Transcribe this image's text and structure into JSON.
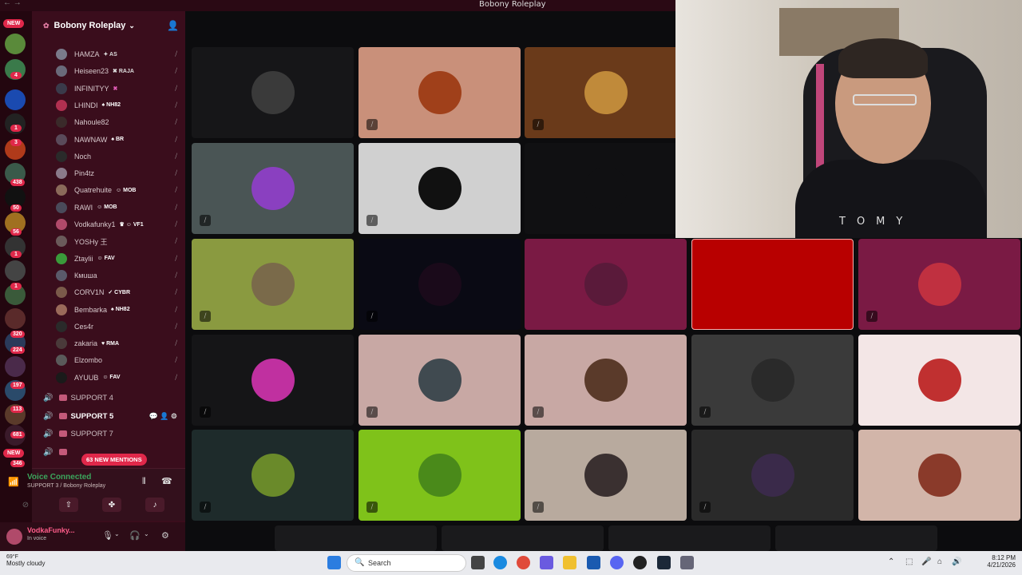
{
  "window": {
    "title": "Bobony Roleplay"
  },
  "rail": {
    "new_top": "NEW",
    "new_bottom": "NEW",
    "badges": [
      "4",
      "1",
      "3",
      "438",
      "50",
      "56",
      "1",
      "1",
      "320",
      "224",
      "197",
      "113",
      "681",
      "346"
    ]
  },
  "server": {
    "name": "Bobony Roleplay"
  },
  "members": [
    {
      "name": "HAMZA",
      "tag": "✦ AS",
      "color": "#7a7a8a",
      "tagcolor": "#ddd"
    },
    {
      "name": "Heiseen23",
      "tag": "✖ RAJA",
      "color": "#6a6a7a",
      "tagcolor": "#ddd"
    },
    {
      "name": "INFINITYY",
      "tag": "✖",
      "color": "#3a3a4a",
      "tagcolor": "#e05bb5"
    },
    {
      "name": "LHINDI",
      "tag": "♠ NH82",
      "color": "#b03050",
      "tagcolor": "#fff"
    },
    {
      "name": "Nahoule82",
      "tag": "",
      "color": "#3a2a2a",
      "tagcolor": "#fff"
    },
    {
      "name": "NAWNAW",
      "tag": "♠ BR",
      "color": "#5a4a5a",
      "tagcolor": "#fff"
    },
    {
      "name": "Noch",
      "tag": "",
      "color": "#2a2a2a",
      "tagcolor": "#fff"
    },
    {
      "name": "Pin4tz",
      "tag": "",
      "color": "#8a7a8a",
      "tagcolor": "#fff"
    },
    {
      "name": "Quatrehuite",
      "tag": "☺ MOB",
      "color": "#8a6a5a",
      "tagcolor": "#fff"
    },
    {
      "name": "RAWI",
      "tag": "☺ MOB",
      "color": "#4a4a5a",
      "tagcolor": "#fff"
    },
    {
      "name": "Vodkafunky1",
      "tag": "♛ ☺ VF1",
      "color": "#b04a6a",
      "tagcolor": "#fff"
    },
    {
      "name": "YOSHy 王",
      "tag": "",
      "color": "#6a5a5a",
      "tagcolor": "#fff"
    },
    {
      "name": "Ztaylii",
      "tag": "☺ FAV",
      "color": "#3a9a3a",
      "tagcolor": "#fff"
    },
    {
      "name": "Кмuша",
      "tag": "",
      "color": "#5a5a6a",
      "tagcolor": "#fff"
    },
    {
      "name": "CORV1N",
      "tag": "✓ CYBR",
      "color": "#7a5a4a",
      "tagcolor": "#fff"
    },
    {
      "name": "Bembarka",
      "tag": "♠ NH82",
      "color": "#9a6a5a",
      "tagcolor": "#fff"
    },
    {
      "name": "Ces4r",
      "tag": "",
      "color": "#2a2a2a",
      "tagcolor": "#fff"
    },
    {
      "name": "zakaria",
      "tag": "♥ RMA",
      "color": "#4a3a3a",
      "tagcolor": "#fff"
    },
    {
      "name": "Elzombo",
      "tag": "",
      "color": "#5a5a5a",
      "tagcolor": "#fff"
    },
    {
      "name": "AYUUB",
      "tag": "☺ FAV",
      "color": "#1a1a1a",
      "tagcolor": "#fff"
    }
  ],
  "channels": [
    {
      "name": "SUPPORT 4",
      "active": false
    },
    {
      "name": "SUPPORT 5",
      "active": true
    },
    {
      "name": "SUPPORT 7",
      "active": false
    },
    {
      "name": "",
      "active": false
    }
  ],
  "mentions": "63 NEW MENTIONS",
  "voice": {
    "status": "Voice Connected",
    "location": "SUPPORT 3 / Bobony Roleplay"
  },
  "user": {
    "name": "VodkaFunky...",
    "status": "In voice"
  },
  "tiles": [
    {
      "bg": "#161618",
      "pic": "#3a3a3a",
      "mute": false
    },
    {
      "bg": "#c9907a",
      "pic": "#a0401a",
      "mute": true
    },
    {
      "bg": "#6a3a1a",
      "pic": "#c08a3a",
      "mute": true
    },
    {
      "bg": "#4a5555",
      "pic": "#8a40c0",
      "mute": true
    },
    {
      "bg": "#d0d0d0",
      "pic": "#111111",
      "mute": true
    },
    {
      "bg": "#101012",
      "pic": "#101012",
      "mute": false
    },
    {
      "bg": "#8a9a40",
      "pic": "#7a6a4a",
      "mute": true
    },
    {
      "bg": "#0a0a14",
      "pic": "#1a0a1a",
      "mute": true
    },
    {
      "bg": "#7a1a44",
      "pic": "#5a1a3a",
      "mute": false
    },
    {
      "bg": "#b80000",
      "pic": "#b80000",
      "mute": false
    },
    {
      "bg": "#7a1a44",
      "pic": "#c03040",
      "mute": true
    },
    {
      "bg": "#151517",
      "pic": "#c030a0",
      "mute": true
    },
    {
      "bg": "#c8a8a4",
      "pic": "#404a50",
      "mute": true
    },
    {
      "bg": "#c8a8a4",
      "pic": "#5a3a2a",
      "mute": true
    },
    {
      "bg": "#3a3a3a",
      "pic": "#2a2a2a",
      "mute": true
    },
    {
      "bg": "#f3e6e6",
      "pic": "#c03030",
      "mute": false
    },
    {
      "bg": "#1e2b2b",
      "pic": "#6a8a2a",
      "mute": true
    },
    {
      "bg": "#7fc21a",
      "pic": "#4a8a1a",
      "mute": true
    },
    {
      "bg": "#b8aa9e",
      "pic": "#3a3030",
      "mute": true
    },
    {
      "bg": "#2a2a2a",
      "pic": "#3a2a4a",
      "mute": true
    },
    {
      "bg": "#d2b5a9",
      "pic": "#8a3a2a",
      "mute": false
    }
  ],
  "webcam": {
    "shirt_text": "TOMY"
  },
  "taskbar": {
    "weather_temp": "69°F",
    "weather_desc": "Mostly cloudy",
    "search_placeholder": "Search",
    "time": "8:12 PM",
    "date": "4/21/2026"
  }
}
